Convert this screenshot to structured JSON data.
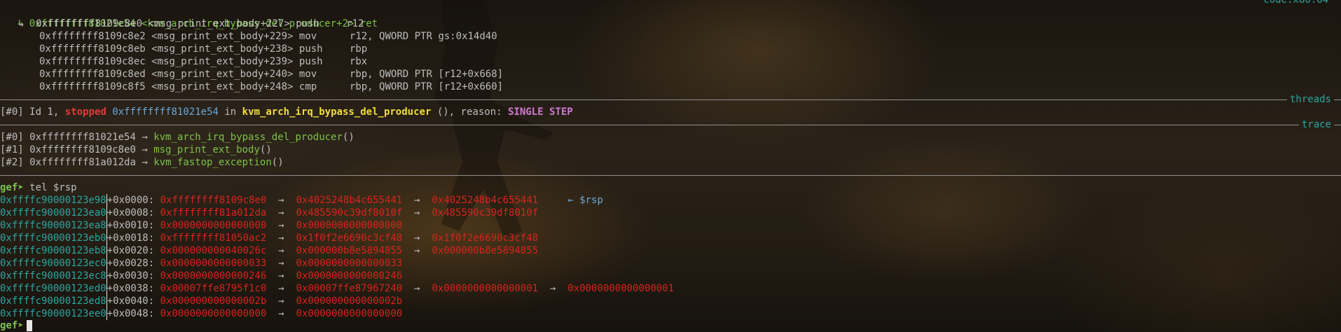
{
  "header": {
    "corner_text": "code:x86:64",
    "current": {
      "arrow": "→",
      "addr": "0xffffffff81021e54",
      "sym": "<kvm_arch_irq_bypass_del_producer+2>",
      "mnem": "ret"
    }
  },
  "code": {
    "return_marker": "↳",
    "lines": [
      {
        "addr": "0xffffffff8109c8e0",
        "sym": "<msg_print_ext_body+227>",
        "mnem": "push",
        "ops": "r12"
      },
      {
        "addr": "0xffffffff8109c8e2",
        "sym": "<msg_print_ext_body+229>",
        "mnem": "mov",
        "ops": "r12, QWORD PTR gs:0x14d40"
      },
      {
        "addr": "0xffffffff8109c8eb",
        "sym": "<msg_print_ext_body+238>",
        "mnem": "push",
        "ops": "rbp"
      },
      {
        "addr": "0xffffffff8109c8ec",
        "sym": "<msg_print_ext_body+239>",
        "mnem": "push",
        "ops": "rbx"
      },
      {
        "addr": "0xffffffff8109c8ed",
        "sym": "<msg_print_ext_body+240>",
        "mnem": "mov",
        "ops": "rbp, QWORD PTR [r12+0x668]"
      },
      {
        "addr": "0xffffffff8109c8f5",
        "sym": "<msg_print_ext_body+248>",
        "mnem": "cmp",
        "ops": "rbp, QWORD PTR [r12+0x660]"
      }
    ]
  },
  "threads": {
    "label": "threads",
    "id_tag": "[#0]",
    "id_text": "Id 1,",
    "state": "stopped",
    "addr": "0xffffffff81021e54",
    "in": "in",
    "func": "kvm_arch_irq_bypass_del_producer",
    "suffix": "(), reason:",
    "reason": "SINGLE STEP"
  },
  "trace": {
    "label": "trace",
    "frames": [
      {
        "tag": "[#0]",
        "addr": "0xffffffff81021e54",
        "arrow": "→",
        "func": "kvm_arch_irq_bypass_del_producer",
        "parens": "()"
      },
      {
        "tag": "[#1]",
        "addr": "0xffffffff8109c8e0",
        "arrow": "→",
        "func": "msg_print_ext_body",
        "parens": "()"
      },
      {
        "tag": "[#2]",
        "addr": "0xffffffff81a012da",
        "arrow": "→",
        "func": "kvm_fastop_exception",
        "parens": "()"
      }
    ]
  },
  "command": {
    "prompt": "gef➤",
    "text": " tel $rsp"
  },
  "telescope": {
    "rows": [
      {
        "addr": "0xffffc90000123e98",
        "off": "+0x0000:",
        "chain": [
          "0xffffffff8109c8e0",
          "0x4025248b4c655441",
          "0x4025248b4c655441"
        ],
        "note": "← $rsp"
      },
      {
        "addr": "0xffffc90000123ea0",
        "off": "+0x0008:",
        "chain": [
          "0xffffffff81a012da",
          "0x485590c39df8010f",
          "0x485590c39df8010f"
        ],
        "note": ""
      },
      {
        "addr": "0xffffc90000123ea8",
        "off": "+0x0010:",
        "chain": [
          "0x0000000000000000",
          "0x0000000000000000"
        ],
        "note": ""
      },
      {
        "addr": "0xffffc90000123eb0",
        "off": "+0x0018:",
        "chain": [
          "0xffffffff81050ac2",
          "0x1f0f2e6690c3cf48",
          "0x1f0f2e6690c3cf48"
        ],
        "note": ""
      },
      {
        "addr": "0xffffc90000123eb8",
        "off": "+0x0020:",
        "chain": [
          "0x000000000040026c",
          "0x000000b8e5894855",
          "0x000000b8e5894855"
        ],
        "note": ""
      },
      {
        "addr": "0xffffc90000123ec0",
        "off": "+0x0028:",
        "chain": [
          "0x0000000000000033",
          "0x0000000000000033"
        ],
        "note": ""
      },
      {
        "addr": "0xffffc90000123ec8",
        "off": "+0x0030:",
        "chain": [
          "0x0000000000000246",
          "0x0000000000000246"
        ],
        "note": ""
      },
      {
        "addr": "0xffffc90000123ed0",
        "off": "+0x0038:",
        "chain": [
          "0x00007ffe8795f1c0",
          "0x00007ffe87967240",
          "0x0000000000000001",
          "0x0000000000000001"
        ],
        "note": ""
      },
      {
        "addr": "0xffffc90000123ed8",
        "off": "+0x0040:",
        "chain": [
          "0x000000000000002b",
          "0x000000000000002b"
        ],
        "note": ""
      },
      {
        "addr": "0xffffc90000123ee0",
        "off": "+0x0048:",
        "chain": [
          "0x0000000000000000",
          "0x0000000000000000"
        ],
        "note": ""
      }
    ],
    "arrow": "→"
  },
  "prompt2": {
    "prompt": "gef➤"
  }
}
